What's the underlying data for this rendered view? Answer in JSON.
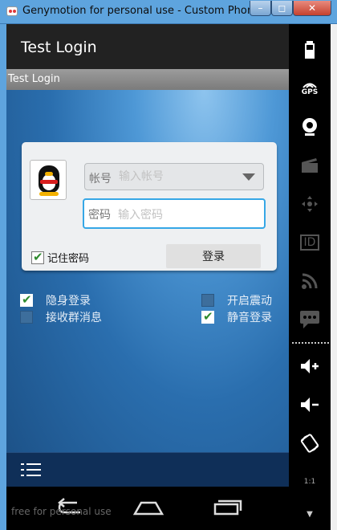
{
  "window": {
    "title": "Genymotion for personal use - Custom Phone ...",
    "min": "–",
    "max": "◻",
    "close": "✕"
  },
  "app": {
    "actionbar_title": "Test Login",
    "subtitle": "Test Login"
  },
  "login": {
    "account_label": "帐号",
    "account_placeholder": "输入帐号",
    "password_label": "密码",
    "password_placeholder": "输入密码",
    "remember_label": "记住密码",
    "remember_checked": true,
    "login_button": "登录"
  },
  "options": [
    {
      "label": "隐身登录",
      "checked": true
    },
    {
      "label": "开启震动",
      "checked": false
    },
    {
      "label": "接收群消息",
      "checked": false
    },
    {
      "label": "静音登录",
      "checked": true
    }
  ],
  "navbar": {
    "watermark": "free for personal use"
  },
  "side_panel": {
    "gps": "GPS",
    "id": "ID",
    "vol_up": "+",
    "vol_down": "–",
    "scale": "1:1"
  }
}
